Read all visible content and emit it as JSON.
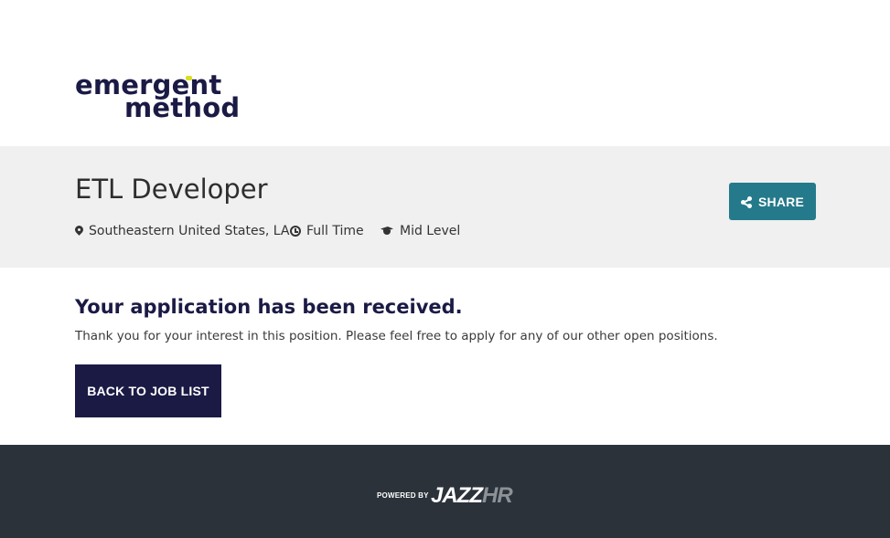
{
  "brand": {
    "line1": "emergent",
    "line2": "method",
    "accent_color": "#d9e021",
    "text_color": "#1b1a45"
  },
  "job": {
    "title": "ETL Developer",
    "location": "Southeastern United States, LA",
    "type": "Full Time",
    "level": "Mid Level",
    "location_icon": "map-pin-icon",
    "type_icon": "clock-icon",
    "level_icon": "graduation-cap-icon"
  },
  "share": {
    "label": "SHARE",
    "icon": "share-icon",
    "color": "#247a8a"
  },
  "confirmation": {
    "heading": "Your application has been received.",
    "message": "Thank you for your interest in this position. Please feel free to apply for any of our other open positions.",
    "back_label": "BACK TO JOB LIST"
  },
  "footer": {
    "powered_by": "POWERED BY",
    "brand_main": "JAZZ",
    "brand_suffix": "HR",
    "background": "#2b323a"
  }
}
